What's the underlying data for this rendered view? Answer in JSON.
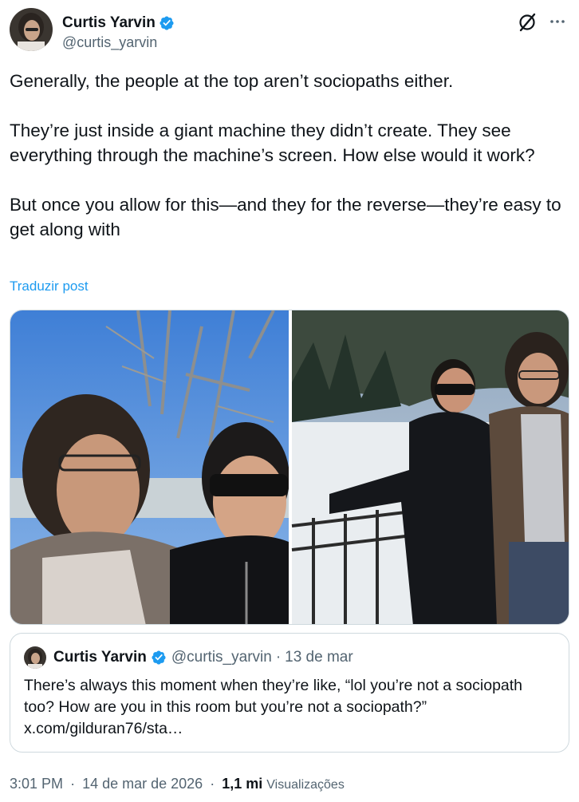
{
  "author": {
    "name": "Curtis Yarvin",
    "handle": "@curtis_yarvin",
    "verified_color": "#1d9bf0"
  },
  "post": {
    "paragraphs": [
      "Generally, the people at the top aren’t sociopaths either.",
      "They’re just inside a giant machine they didn’t create. They see everything through the machine’s screen. How else would it work?",
      "But once you allow for this—and they for the reverse—they’re easy to get along with"
    ],
    "translate_link": "Traduzir post"
  },
  "quoted": {
    "name": "Curtis Yarvin",
    "handle": "@curtis_yarvin",
    "separator": "·",
    "date": "13 de mar",
    "text": "There’s always this moment when they’re like, “lol you’re not a sociopath too? How are you in this room but you’re not a sociopath?” x.com/gilduran76/sta…"
  },
  "footer": {
    "time": "3:01 PM",
    "separator": "·",
    "date": "14 de mar de 2026",
    "views_count": "1,1 mi",
    "views_label": "Visualizações"
  },
  "icons": {
    "grok": "grok-icon",
    "more": "more-dots-icon",
    "verified": "verified-badge-icon"
  },
  "colors": {
    "link": "#1d9bf0",
    "secondary_text": "#536471",
    "border": "#cfd9de"
  }
}
